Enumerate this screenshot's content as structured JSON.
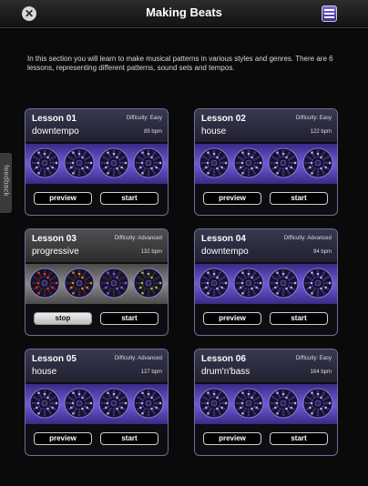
{
  "header": {
    "title": "Making Beats"
  },
  "intro": "In this section you will learn to make musical patterns in various styles and genres. There are 6 lessons, representing different patterns, sound sets and tempos.",
  "feedback_label": "feedback",
  "colors": {
    "purple_band": "#6e5cd8",
    "active_band": "#8a8a8a"
  },
  "lessons": [
    {
      "name": "Lesson 01",
      "difficulty": "Difficulty: Easy",
      "style": "downtempo",
      "bpm": "89 bpm",
      "btn1": "preview",
      "btn2": "start",
      "active": false
    },
    {
      "name": "Lesson 02",
      "difficulty": "Difficulty: Easy",
      "style": "house",
      "bpm": "122 bpm",
      "btn1": "preview",
      "btn2": "start",
      "active": false
    },
    {
      "name": "Lesson 03",
      "difficulty": "Difficulty: Advanced",
      "style": "progressive",
      "bpm": "132 bpm",
      "btn1": "stop",
      "btn2": "start",
      "active": true
    },
    {
      "name": "Lesson 04",
      "difficulty": "Difficulty: Advanced",
      "style": "downtempo",
      "bpm": "94 bpm",
      "btn1": "preview",
      "btn2": "start",
      "active": false
    },
    {
      "name": "Lesson 05",
      "difficulty": "Difficulty: Advanced",
      "style": "house",
      "bpm": "127 bpm",
      "btn1": "preview",
      "btn2": "start",
      "active": false
    },
    {
      "name": "Lesson 06",
      "difficulty": "Difficulty: Easy",
      "style": "drum'n'bass",
      "bpm": "164 bpm",
      "btn1": "preview",
      "btn2": "start",
      "active": false
    }
  ]
}
